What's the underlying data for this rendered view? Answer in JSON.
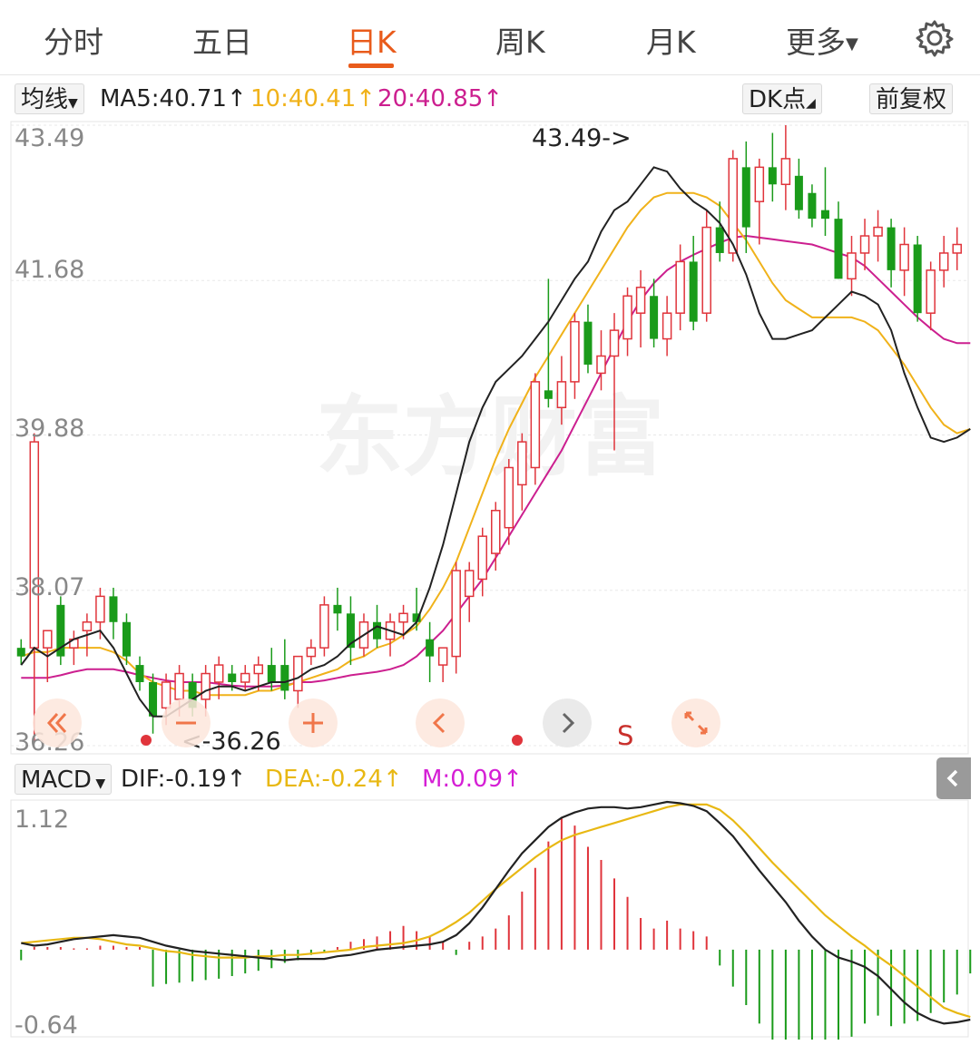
{
  "tabs": [
    {
      "label": "分时",
      "active": false
    },
    {
      "label": "五日",
      "active": false
    },
    {
      "label": "日K",
      "active": true
    },
    {
      "label": "周K",
      "active": false
    },
    {
      "label": "月K",
      "active": false
    },
    {
      "label": "更多",
      "active": false
    }
  ],
  "settings_icon": "gear-icon",
  "ma_bar": {
    "selector": "均线",
    "ma5": "MA5:40.71",
    "ma10": "10:40.41",
    "ma20": "20:40.85",
    "arrow": "↑",
    "dk_button": "DK点",
    "adjust_button": "前复权"
  },
  "colors": {
    "up": "#e0343b",
    "down": "#1a9b1a",
    "ma5": "#222222",
    "ma10": "#f0b21a",
    "ma20": "#cc1f8f",
    "dif": "#222222",
    "dea": "#e8b813",
    "accent": "#e95b1b"
  },
  "watermark": "东方财富",
  "price_axis": [
    "43.49",
    "41.68",
    "39.88",
    "38.07",
    "36.26"
  ],
  "annotations": {
    "high": "43.49->",
    "low": "<-36.26"
  },
  "float_buttons": {
    "signal": "S"
  },
  "macd_bar": {
    "selector": "MACD",
    "dif": "DIF:-0.19",
    "dea": "DEA:-0.24",
    "m": "M:0.09",
    "arrow": "↑"
  },
  "macd_axis": [
    "1.12",
    "-0.64"
  ],
  "chart_data": [
    {
      "type": "candlestick",
      "ylim": [
        36.26,
        43.49
      ],
      "grid": true,
      "series": [
        {
          "name": "MA5",
          "values": [
            37.2,
            37.4,
            37.3,
            37.4,
            37.5,
            37.55,
            37.6,
            37.4,
            37.1,
            36.8,
            36.6,
            36.6,
            36.7,
            36.8,
            36.9,
            36.95,
            36.95,
            36.9,
            36.95,
            37.0,
            37.0,
            37.05,
            37.15,
            37.2,
            37.3,
            37.45,
            37.55,
            37.65,
            37.6,
            37.55,
            37.7,
            38.1,
            38.6,
            39.2,
            39.8,
            40.2,
            40.5,
            40.65,
            40.8,
            41.0,
            41.2,
            41.45,
            41.7,
            41.9,
            42.25,
            42.5,
            42.6,
            42.8,
            43.0,
            42.95,
            42.75,
            42.6,
            42.5,
            42.35,
            42.1,
            41.75,
            41.3,
            41.0,
            41.0,
            41.05,
            41.1,
            41.25,
            41.4,
            41.55,
            41.5,
            41.4,
            41.1,
            40.6,
            40.2,
            39.85,
            39.8,
            39.85,
            39.95
          ]
        },
        {
          "name": "MA10",
          "values": [
            37.3,
            37.35,
            37.35,
            37.4,
            37.4,
            37.4,
            37.4,
            37.35,
            37.25,
            37.1,
            37.0,
            36.95,
            36.9,
            36.9,
            36.85,
            36.85,
            36.85,
            36.85,
            36.9,
            36.9,
            36.95,
            37.0,
            37.05,
            37.1,
            37.15,
            37.25,
            37.3,
            37.4,
            37.45,
            37.55,
            37.65,
            37.85,
            38.1,
            38.4,
            38.8,
            39.2,
            39.6,
            39.95,
            40.25,
            40.55,
            40.8,
            41.05,
            41.3,
            41.55,
            41.8,
            42.05,
            42.3,
            42.5,
            42.65,
            42.7,
            42.7,
            42.7,
            42.65,
            42.55,
            42.35,
            42.15,
            41.9,
            41.65,
            41.45,
            41.35,
            41.25,
            41.25,
            41.25,
            41.25,
            41.2,
            41.1,
            40.9,
            40.7,
            40.45,
            40.2,
            40.0,
            39.9,
            39.95
          ]
        },
        {
          "name": "MA20",
          "values": [
            37.05,
            37.05,
            37.05,
            37.08,
            37.12,
            37.15,
            37.15,
            37.15,
            37.12,
            37.08,
            37.05,
            37.02,
            37.0,
            37.0,
            37.0,
            36.98,
            36.96,
            36.95,
            36.95,
            36.95,
            36.96,
            37.0,
            37.0,
            37.02,
            37.05,
            37.08,
            37.1,
            37.12,
            37.15,
            37.2,
            37.3,
            37.45,
            37.6,
            37.8,
            38.0,
            38.2,
            38.45,
            38.7,
            38.95,
            39.2,
            39.45,
            39.7,
            40.0,
            40.3,
            40.6,
            40.9,
            41.2,
            41.45,
            41.65,
            41.8,
            41.9,
            41.98,
            42.05,
            42.12,
            42.18,
            42.2,
            42.18,
            42.16,
            42.14,
            42.12,
            42.1,
            42.05,
            42.0,
            41.95,
            41.85,
            41.7,
            41.55,
            41.4,
            41.25,
            41.12,
            41.0,
            40.95,
            40.95
          ]
        }
      ],
      "candles": [
        {
          "o": 37.4,
          "h": 37.5,
          "l": 37.2,
          "c": 37.3
        },
        {
          "o": 37.4,
          "h": 39.9,
          "l": 36.3,
          "c": 39.8
        },
        {
          "o": 37.4,
          "h": 37.6,
          "l": 37.0,
          "c": 37.6
        },
        {
          "o": 37.9,
          "h": 38.0,
          "l": 37.2,
          "c": 37.3
        },
        {
          "o": 37.4,
          "h": 37.6,
          "l": 37.2,
          "c": 37.5
        },
        {
          "o": 37.6,
          "h": 37.8,
          "l": 37.3,
          "c": 37.7
        },
        {
          "o": 37.7,
          "h": 38.1,
          "l": 37.5,
          "c": 38.0
        },
        {
          "o": 38.0,
          "h": 38.1,
          "l": 37.5,
          "c": 37.7
        },
        {
          "o": 37.7,
          "h": 37.8,
          "l": 37.2,
          "c": 37.3
        },
        {
          "o": 37.2,
          "h": 37.3,
          "l": 36.9,
          "c": 37.0
        },
        {
          "o": 37.0,
          "h": 37.1,
          "l": 36.4,
          "c": 36.6
        },
        {
          "o": 36.7,
          "h": 37.1,
          "l": 36.5,
          "c": 37.0
        },
        {
          "o": 36.8,
          "h": 37.2,
          "l": 36.6,
          "c": 37.1
        },
        {
          "o": 37.0,
          "h": 37.1,
          "l": 36.6,
          "c": 36.7
        },
        {
          "o": 36.8,
          "h": 37.2,
          "l": 36.6,
          "c": 37.1
        },
        {
          "o": 37.0,
          "h": 37.3,
          "l": 36.8,
          "c": 37.2
        },
        {
          "o": 37.1,
          "h": 37.2,
          "l": 36.9,
          "c": 37.0
        },
        {
          "o": 37.0,
          "h": 37.2,
          "l": 36.9,
          "c": 37.1
        },
        {
          "o": 37.1,
          "h": 37.3,
          "l": 36.9,
          "c": 37.2
        },
        {
          "o": 37.2,
          "h": 37.4,
          "l": 36.9,
          "c": 37.0
        },
        {
          "o": 37.2,
          "h": 37.5,
          "l": 36.8,
          "c": 36.9
        },
        {
          "o": 36.9,
          "h": 37.3,
          "l": 36.7,
          "c": 37.3
        },
        {
          "o": 37.3,
          "h": 37.5,
          "l": 37.2,
          "c": 37.4
        },
        {
          "o": 37.4,
          "h": 38.0,
          "l": 37.3,
          "c": 37.9
        },
        {
          "o": 37.9,
          "h": 38.1,
          "l": 37.6,
          "c": 37.8
        },
        {
          "o": 37.8,
          "h": 38.0,
          "l": 37.2,
          "c": 37.4
        },
        {
          "o": 37.4,
          "h": 37.8,
          "l": 37.3,
          "c": 37.7
        },
        {
          "o": 37.7,
          "h": 37.9,
          "l": 37.4,
          "c": 37.5
        },
        {
          "o": 37.5,
          "h": 37.8,
          "l": 37.3,
          "c": 37.7
        },
        {
          "o": 37.7,
          "h": 37.9,
          "l": 37.5,
          "c": 37.8
        },
        {
          "o": 37.8,
          "h": 38.1,
          "l": 37.6,
          "c": 37.7
        },
        {
          "o": 37.5,
          "h": 37.7,
          "l": 37.0,
          "c": 37.3
        },
        {
          "o": 37.2,
          "h": 37.4,
          "l": 37.0,
          "c": 37.4
        },
        {
          "o": 37.3,
          "h": 38.4,
          "l": 37.1,
          "c": 38.3
        },
        {
          "o": 38.0,
          "h": 38.4,
          "l": 37.7,
          "c": 38.3
        },
        {
          "o": 38.2,
          "h": 38.8,
          "l": 38.0,
          "c": 38.7
        },
        {
          "o": 38.5,
          "h": 39.1,
          "l": 38.3,
          "c": 39.0
        },
        {
          "o": 38.8,
          "h": 39.6,
          "l": 38.6,
          "c": 39.5
        },
        {
          "o": 39.3,
          "h": 39.9,
          "l": 39.0,
          "c": 39.8
        },
        {
          "o": 39.5,
          "h": 40.6,
          "l": 39.3,
          "c": 40.5
        },
        {
          "o": 40.4,
          "h": 41.7,
          "l": 40.2,
          "c": 40.3
        },
        {
          "o": 40.2,
          "h": 40.8,
          "l": 40.0,
          "c": 40.5
        },
        {
          "o": 40.5,
          "h": 41.3,
          "l": 40.3,
          "c": 41.2
        },
        {
          "o": 41.2,
          "h": 41.4,
          "l": 40.6,
          "c": 40.7
        },
        {
          "o": 40.6,
          "h": 41.1,
          "l": 40.4,
          "c": 40.8
        },
        {
          "o": 40.8,
          "h": 41.3,
          "l": 39.7,
          "c": 41.1
        },
        {
          "o": 41.0,
          "h": 41.6,
          "l": 40.8,
          "c": 41.5
        },
        {
          "o": 41.3,
          "h": 41.8,
          "l": 40.9,
          "c": 41.6
        },
        {
          "o": 41.5,
          "h": 41.7,
          "l": 40.9,
          "c": 41.0
        },
        {
          "o": 41.0,
          "h": 41.5,
          "l": 40.8,
          "c": 41.3
        },
        {
          "o": 41.3,
          "h": 42.1,
          "l": 41.1,
          "c": 41.9
        },
        {
          "o": 41.9,
          "h": 42.2,
          "l": 41.1,
          "c": 41.2
        },
        {
          "o": 41.3,
          "h": 42.5,
          "l": 41.2,
          "c": 42.3
        },
        {
          "o": 42.3,
          "h": 42.6,
          "l": 41.9,
          "c": 42.0
        },
        {
          "o": 42.0,
          "h": 43.2,
          "l": 41.9,
          "c": 43.1
        },
        {
          "o": 43.0,
          "h": 43.3,
          "l": 42.0,
          "c": 42.3
        },
        {
          "o": 42.6,
          "h": 43.1,
          "l": 42.1,
          "c": 43.0
        },
        {
          "o": 43.0,
          "h": 43.4,
          "l": 42.6,
          "c": 42.8
        },
        {
          "o": 42.8,
          "h": 43.49,
          "l": 42.5,
          "c": 43.1
        },
        {
          "o": 42.9,
          "h": 43.1,
          "l": 42.4,
          "c": 42.5
        },
        {
          "o": 42.7,
          "h": 42.8,
          "l": 42.3,
          "c": 42.4
        },
        {
          "o": 42.5,
          "h": 43.0,
          "l": 42.2,
          "c": 42.4
        },
        {
          "o": 42.4,
          "h": 42.6,
          "l": 41.7,
          "c": 41.7
        },
        {
          "o": 41.7,
          "h": 42.2,
          "l": 41.5,
          "c": 42.0
        },
        {
          "o": 42.0,
          "h": 42.4,
          "l": 41.8,
          "c": 42.2
        },
        {
          "o": 42.2,
          "h": 42.5,
          "l": 41.9,
          "c": 42.3
        },
        {
          "o": 42.3,
          "h": 42.4,
          "l": 41.6,
          "c": 41.8
        },
        {
          "o": 41.8,
          "h": 42.3,
          "l": 41.5,
          "c": 42.1
        },
        {
          "o": 42.1,
          "h": 42.2,
          "l": 41.2,
          "c": 41.3
        },
        {
          "o": 41.3,
          "h": 41.9,
          "l": 41.1,
          "c": 41.8
        },
        {
          "o": 41.8,
          "h": 42.2,
          "l": 41.6,
          "c": 42.0
        },
        {
          "o": 42.0,
          "h": 42.3,
          "l": 41.8,
          "c": 42.1
        }
      ]
    },
    {
      "type": "macd",
      "ylim": [
        -0.64,
        1.12
      ],
      "series": [
        {
          "name": "DIF",
          "values": [
            0.05,
            0.03,
            0.04,
            0.06,
            0.08,
            0.09,
            0.1,
            0.11,
            0.1,
            0.09,
            0.06,
            0.03,
            0.01,
            -0.01,
            -0.02,
            -0.03,
            -0.04,
            -0.05,
            -0.06,
            -0.07,
            -0.08,
            -0.07,
            -0.07,
            -0.07,
            -0.05,
            -0.04,
            -0.02,
            0.0,
            0.01,
            0.02,
            0.03,
            0.04,
            0.06,
            0.11,
            0.2,
            0.32,
            0.46,
            0.6,
            0.73,
            0.83,
            0.93,
            1.0,
            1.04,
            1.07,
            1.08,
            1.08,
            1.07,
            1.08,
            1.1,
            1.12,
            1.11,
            1.09,
            1.05,
            0.96,
            0.86,
            0.73,
            0.6,
            0.48,
            0.36,
            0.22,
            0.1,
            0.0,
            -0.06,
            -0.09,
            -0.13,
            -0.2,
            -0.3,
            -0.4,
            -0.48,
            -0.53,
            -0.56,
            -0.55,
            -0.53
          ]
        },
        {
          "name": "DEA",
          "values": [
            0.05,
            0.06,
            0.07,
            0.08,
            0.09,
            0.09,
            0.08,
            0.06,
            0.04,
            0.03,
            0.01,
            -0.01,
            -0.02,
            -0.04,
            -0.05,
            -0.06,
            -0.06,
            -0.06,
            -0.05,
            -0.05,
            -0.04,
            -0.04,
            -0.03,
            -0.02,
            -0.01,
            0.0,
            0.02,
            0.03,
            0.04,
            0.05,
            0.07,
            0.1,
            0.15,
            0.21,
            0.28,
            0.37,
            0.46,
            0.54,
            0.62,
            0.7,
            0.77,
            0.83,
            0.87,
            0.9,
            0.93,
            0.96,
            0.99,
            1.02,
            1.05,
            1.08,
            1.1,
            1.1,
            1.1,
            1.06,
            0.98,
            0.88,
            0.77,
            0.66,
            0.56,
            0.46,
            0.36,
            0.26,
            0.18,
            0.1,
            0.03,
            -0.05,
            -0.12,
            -0.2,
            -0.28,
            -0.36,
            -0.44,
            -0.48,
            -0.51
          ]
        },
        {
          "name": "M",
          "values": [
            -0.08,
            0.02,
            0.02,
            0.02,
            0.01,
            0.01,
            0.03,
            0.03,
            0.02,
            0.02,
            -0.28,
            -0.26,
            -0.25,
            -0.24,
            -0.23,
            -0.22,
            -0.2,
            -0.18,
            -0.16,
            -0.14,
            -0.1,
            -0.08,
            -0.04,
            -0.02,
            0.02,
            0.06,
            0.08,
            0.1,
            0.14,
            0.18,
            0.14,
            0.1,
            0.06,
            -0.04,
            0.06,
            0.1,
            0.16,
            0.26,
            0.44,
            0.62,
            0.82,
            1.0,
            0.94,
            0.78,
            0.68,
            0.54,
            0.4,
            0.24,
            0.16,
            0.22,
            0.16,
            0.14,
            0.1,
            -0.12,
            -0.28,
            -0.42,
            -0.56,
            -0.7,
            -0.8,
            -0.9,
            -0.92,
            -0.86,
            -0.78,
            -0.66,
            -0.56,
            -0.5,
            -0.58,
            -0.56,
            -0.54,
            -0.48,
            -0.4,
            -0.34,
            -0.18
          ]
        }
      ]
    }
  ]
}
